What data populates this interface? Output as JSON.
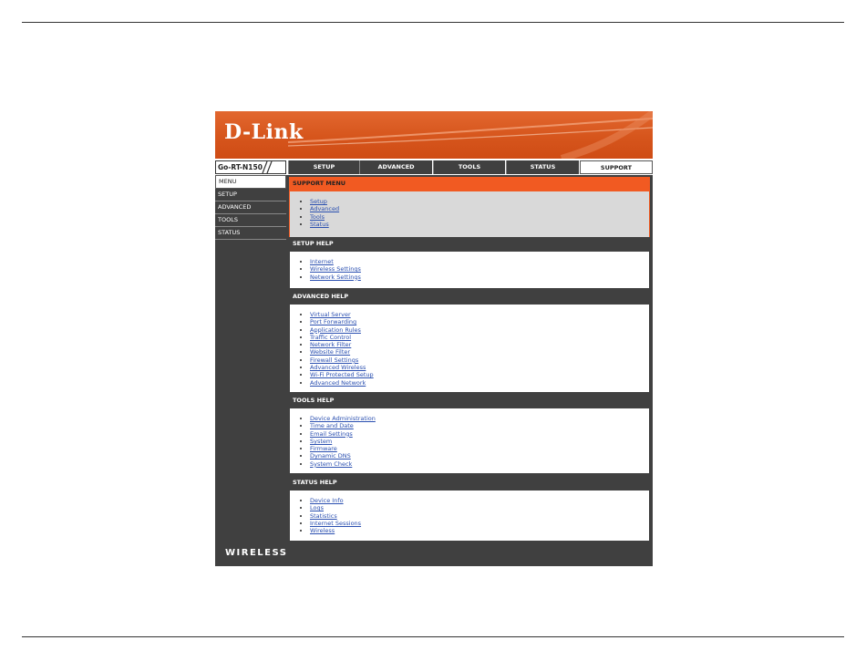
{
  "brand": {
    "logo": "D-Link",
    "model": "Go-RT-N150",
    "footer": "WIRELESS"
  },
  "colors": {
    "accent": "#f15a22",
    "dark": "#404040",
    "link": "#2a4fb0"
  },
  "tabs": [
    {
      "label": "SETUP"
    },
    {
      "label": "ADVANCED"
    },
    {
      "label": "TOOLS"
    },
    {
      "label": "STATUS"
    },
    {
      "label": "SUPPORT",
      "active": true
    }
  ],
  "sidebar": {
    "items": [
      {
        "label": "MENU",
        "active": true
      },
      {
        "label": "SETUP"
      },
      {
        "label": "ADVANCED"
      },
      {
        "label": "TOOLS"
      },
      {
        "label": "STATUS"
      }
    ]
  },
  "panels": [
    {
      "title": "SUPPORT MENU",
      "links": [
        "Setup",
        "Advanced",
        "Tools",
        "Status"
      ]
    },
    {
      "title": "SETUP HELP",
      "links": [
        "Internet",
        "Wireless Settings",
        "Network Settings"
      ]
    },
    {
      "title": "ADVANCED HELP",
      "links": [
        "Virtual Server",
        "Port Forwarding",
        "Application Rules",
        "Traffic Control",
        "Network Filter",
        "Website Filter",
        "Firewall Settings",
        "Advanced Wireless",
        "Wi-Fi Protected Setup",
        "Advanced Network"
      ]
    },
    {
      "title": "TOOLS HELP",
      "links": [
        "Device Administration",
        "Time and Date",
        "Email Settings",
        "System",
        "Firmware",
        "Dynamic DNS",
        "System Check"
      ]
    },
    {
      "title": "STATUS HELP",
      "links": [
        "Device Info",
        "Logs",
        "Statistics",
        "Internet Sessions",
        "Wireless"
      ]
    }
  ]
}
